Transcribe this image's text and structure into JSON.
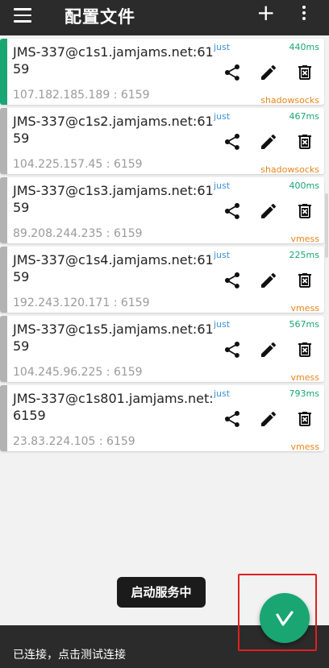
{
  "appbar": {
    "title": "配置文件"
  },
  "colors": {
    "selected": "#19a672",
    "unselected": "#b3b3b3",
    "accent": "#19a672"
  },
  "servers": [
    {
      "remarks": "JMS-337@c1s1.jamjams.net:6159",
      "address": "107.182.185.189 : 6159",
      "test": "just",
      "delay": "440ms",
      "type": "shadowsocks",
      "selected": true
    },
    {
      "remarks": "JMS-337@c1s2.jamjams.net:6159",
      "address": "104.225.157.45 : 6159",
      "test": "just",
      "delay": "467ms",
      "type": "shadowsocks",
      "selected": false
    },
    {
      "remarks": "JMS-337@c1s3.jamjams.net:6159",
      "address": "89.208.244.235 : 6159",
      "test": "just",
      "delay": "400ms",
      "type": "vmess",
      "selected": false
    },
    {
      "remarks": "JMS-337@c1s4.jamjams.net:6159",
      "address": "192.243.120.171 : 6159",
      "test": "just",
      "delay": "225ms",
      "type": "vmess",
      "selected": false
    },
    {
      "remarks": "JMS-337@c1s5.jamjams.net:6159",
      "address": "104.245.96.225 : 6159",
      "test": "just",
      "delay": "567ms",
      "type": "vmess",
      "selected": false
    },
    {
      "remarks": "JMS-337@c1s801.jamjams.net:6159",
      "address": "23.83.224.105 : 6159",
      "test": "just",
      "delay": "793ms",
      "type": "vmess",
      "selected": false
    }
  ],
  "toast": "启动服务中",
  "status": "已连接，点击测试连接",
  "icons": {
    "menu": "menu-icon",
    "add": "add-icon",
    "more": "more-vert-icon",
    "share": "share-icon",
    "edit": "edit-icon",
    "delete": "delete-icon",
    "fab": "v-logo-icon"
  }
}
